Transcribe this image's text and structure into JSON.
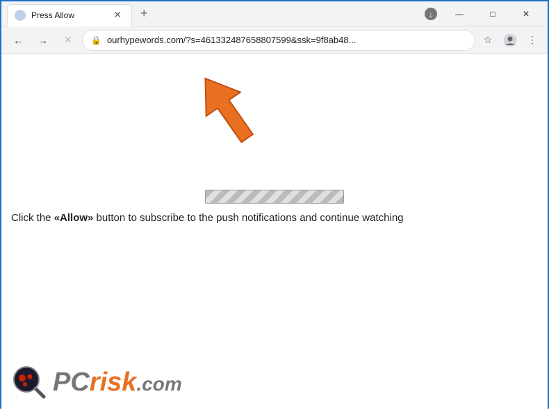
{
  "window": {
    "title": "Press Allow",
    "url": "ourhypewords.com/?s=461332487658807599&ssk=9f8ab48...",
    "tab_title": "Press Allow"
  },
  "nav": {
    "back_label": "←",
    "forward_label": "→",
    "close_label": "✕",
    "star_label": "☆",
    "new_tab_label": "+",
    "lock_icon": "🔒"
  },
  "window_controls": {
    "minimize": "—",
    "maximize": "□",
    "close": "✕"
  },
  "page": {
    "instruction": "Click the «Allow» button to subscribe to the push notifications and continue watching",
    "instruction_prefix": "Click the ",
    "instruction_bold": "«Allow»",
    "instruction_suffix": " button to subscribe to the push notifications and continue watching"
  },
  "logo": {
    "text_pc": "PC",
    "text_risk": "risk",
    "text_dotcom": ".com"
  },
  "colors": {
    "arrow_orange": "#e87020",
    "browser_blue_border": "#1a6fc4"
  }
}
